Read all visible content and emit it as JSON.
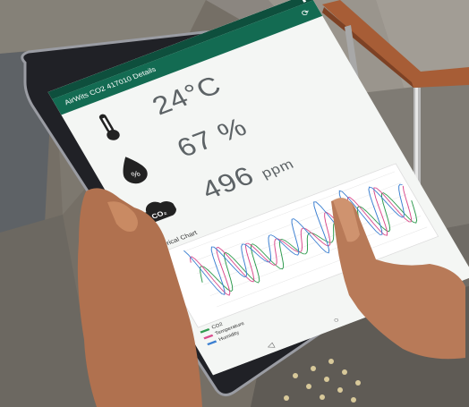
{
  "app": {
    "title": "AirWits CO2 417010 Details",
    "refresh_icon": "refresh-icon",
    "menu_icon": "more-vert-icon"
  },
  "metrics": {
    "temperature": {
      "value": "24°C",
      "icon": "thermometer-icon"
    },
    "humidity": {
      "value": "67 %",
      "icon": "humidity-drop-icon"
    },
    "co2": {
      "value": "496",
      "unit": "ppm",
      "icon": "co2-cloud-icon",
      "icon_text": "CO₂"
    }
  },
  "chart": {
    "title": "Historical Chart",
    "legend": [
      "CO2",
      "Temperature",
      "Humidity"
    ],
    "chart_data": {
      "type": "line",
      "series": [
        {
          "name": "CO2"
        },
        {
          "name": "Temperature"
        },
        {
          "name": "Humidity"
        }
      ]
    }
  },
  "colors": {
    "appbar": "#136b52",
    "statusbar": "#0e4f3d",
    "co2_line": "#2f9b4f",
    "temperature_line": "#d94b8c",
    "humidity_line": "#3b7fd1"
  }
}
